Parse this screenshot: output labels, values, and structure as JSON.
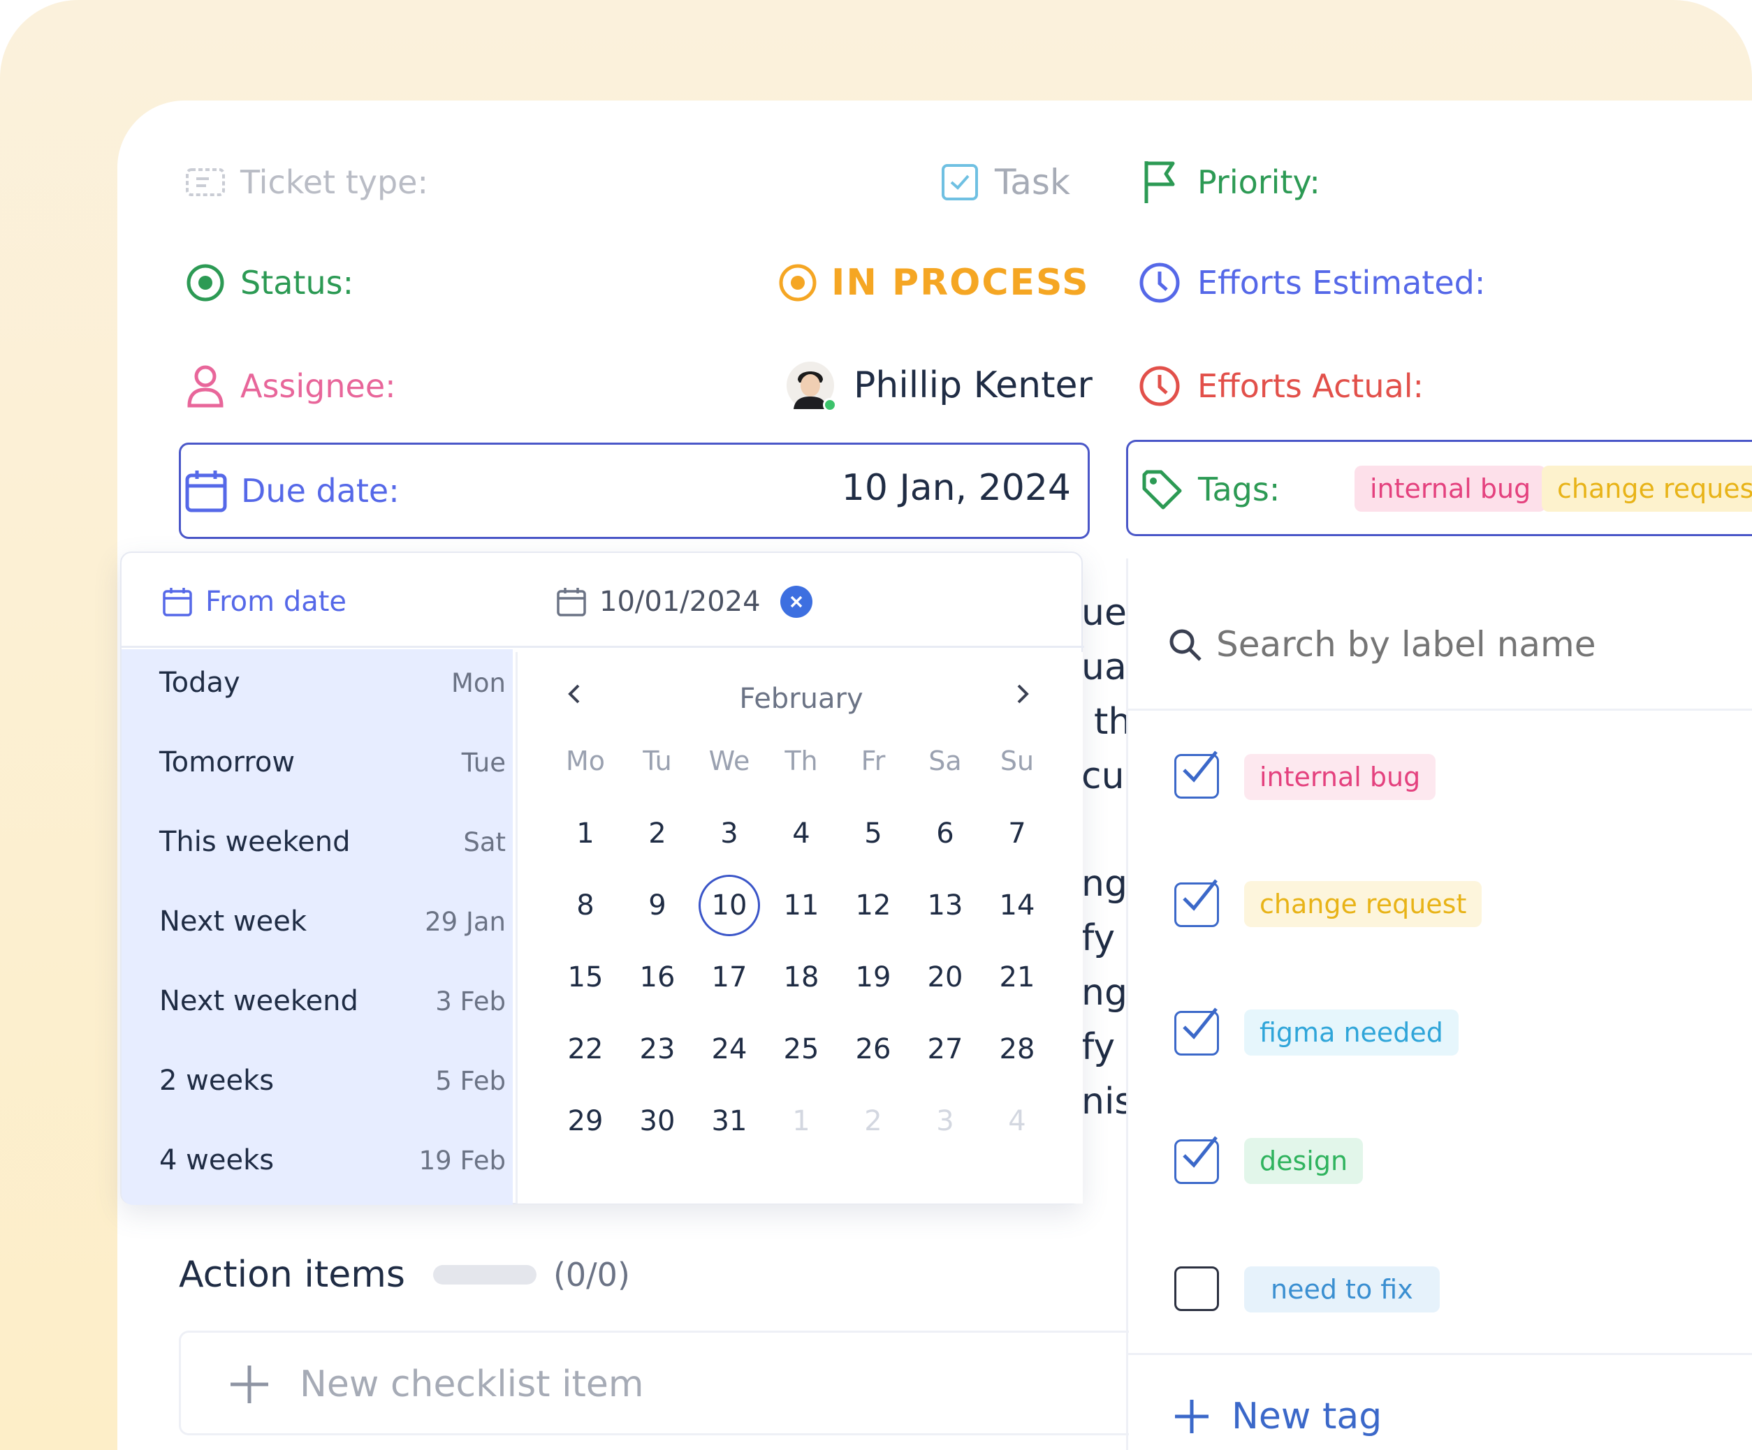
{
  "fields": {
    "ticket_type": {
      "label": "Ticket type:",
      "value": "Task"
    },
    "status": {
      "label": "Status:",
      "value": "IN PROCESS"
    },
    "assignee": {
      "label": "Assignee:",
      "value": "Phillip Kenter"
    },
    "due_date": {
      "label": "Due date:",
      "value": "10 Jan, 2024"
    },
    "priority": {
      "label": "Priority:"
    },
    "efforts_estimated": {
      "label": "Efforts Estimated:"
    },
    "efforts_actual": {
      "label": "Efforts Actual:"
    },
    "tags": {
      "label": "Tags:",
      "chips": [
        "internal bug",
        "change request"
      ]
    }
  },
  "date_popup": {
    "from_label": "From date",
    "input_value": "10/01/2024",
    "presets": [
      {
        "name": "Today",
        "value": "Mon"
      },
      {
        "name": "Tomorrow",
        "value": "Tue"
      },
      {
        "name": "This weekend",
        "value": "Sat"
      },
      {
        "name": "Next week",
        "value": "29 Jan"
      },
      {
        "name": "Next weekend",
        "value": "3 Feb"
      },
      {
        "name": "2 weeks",
        "value": "5 Feb"
      },
      {
        "name": "4 weeks",
        "value": "19 Feb"
      }
    ],
    "calendar": {
      "month": "February",
      "weekdays": [
        "Mo",
        "Tu",
        "We",
        "Th",
        "Fr",
        "Sa",
        "Su"
      ],
      "weeks": [
        [
          "1",
          "2",
          "3",
          "4",
          "5",
          "6",
          "7"
        ],
        [
          "8",
          "9",
          "10",
          "11",
          "12",
          "13",
          "14"
        ],
        [
          "15",
          "16",
          "17",
          "18",
          "19",
          "20",
          "21"
        ],
        [
          "22",
          "23",
          "24",
          "25",
          "26",
          "27",
          "28"
        ],
        [
          "29",
          "30",
          "31",
          "1",
          "2",
          "3",
          "4"
        ]
      ],
      "selected": "10"
    }
  },
  "tag_panel": {
    "search_placeholder": "Search by label name",
    "items": [
      {
        "label": "internal bug",
        "checked": true
      },
      {
        "label": "change request",
        "checked": true
      },
      {
        "label": "figma needed",
        "checked": true
      },
      {
        "label": "design",
        "checked": true
      },
      {
        "label": "need to fix",
        "checked": false
      }
    ],
    "new_tag_label": "New tag"
  },
  "action_items": {
    "title": "Action items",
    "count": "(0/0)",
    "new_item_placeholder": "New checklist item"
  },
  "background_text": [
    "ue",
    "ual",
    "th",
    "cu",
    "ng",
    "fy",
    "ng",
    "fy",
    "nis"
  ],
  "colors": {
    "green": "#2c9a54",
    "orange": "#f5a623",
    "pink": "#e8669a",
    "indigo": "#5568e8",
    "red": "#e2504a",
    "navy": "#4a57c8"
  }
}
